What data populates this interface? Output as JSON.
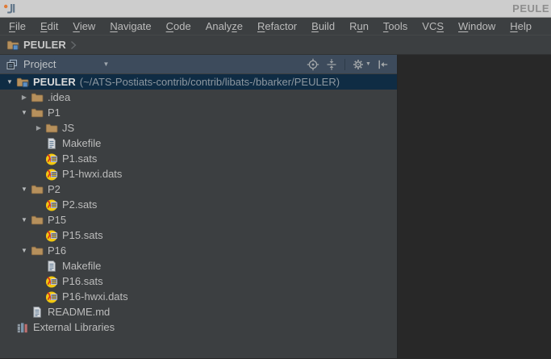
{
  "window": {
    "title": "PEULE"
  },
  "menu_bar": {
    "items": [
      {
        "label": "File",
        "mnemonic": 0
      },
      {
        "label": "Edit",
        "mnemonic": 0
      },
      {
        "label": "View",
        "mnemonic": 0
      },
      {
        "label": "Navigate",
        "mnemonic": 0
      },
      {
        "label": "Code",
        "mnemonic": 0
      },
      {
        "label": "Analyze",
        "mnemonic": 5
      },
      {
        "label": "Refactor",
        "mnemonic": 0
      },
      {
        "label": "Build",
        "mnemonic": 0
      },
      {
        "label": "Run",
        "mnemonic": 1
      },
      {
        "label": "Tools",
        "mnemonic": 0
      },
      {
        "label": "VCS",
        "mnemonic": 2
      },
      {
        "label": "Window",
        "mnemonic": 0
      },
      {
        "label": "Help",
        "mnemonic": 0
      }
    ]
  },
  "nav_bar": {
    "crumb": "PEULER"
  },
  "project_panel": {
    "header": {
      "title": "Project"
    },
    "tree": [
      {
        "label": "PEULER",
        "suffix": "(~/ATS-Postiats-contrib/contrib/libats-/bbarker/PEULER)",
        "level": 0,
        "arrow": "expanded",
        "icon": "project-folder",
        "selected": true,
        "bold": true
      },
      {
        "label": ".idea",
        "level": 1,
        "arrow": "collapsed",
        "icon": "folder"
      },
      {
        "label": "P1",
        "level": 1,
        "arrow": "expanded",
        "icon": "folder"
      },
      {
        "label": "JS",
        "level": 2,
        "arrow": "collapsed",
        "icon": "folder"
      },
      {
        "label": "Makefile",
        "level": 2,
        "icon": "text-file"
      },
      {
        "label": "P1.sats",
        "level": 2,
        "icon": "ats-file"
      },
      {
        "label": "P1-hwxi.dats",
        "level": 2,
        "icon": "ats-file"
      },
      {
        "label": "P2",
        "level": 1,
        "arrow": "expanded",
        "icon": "folder"
      },
      {
        "label": "P2.sats",
        "level": 2,
        "icon": "ats-file"
      },
      {
        "label": "P15",
        "level": 1,
        "arrow": "expanded",
        "icon": "folder"
      },
      {
        "label": "P15.sats",
        "level": 2,
        "icon": "ats-file"
      },
      {
        "label": "P16",
        "level": 1,
        "arrow": "expanded",
        "icon": "folder"
      },
      {
        "label": "Makefile",
        "level": 2,
        "icon": "text-file"
      },
      {
        "label": "P16.sats",
        "level": 2,
        "icon": "ats-file"
      },
      {
        "label": "P16-hwxi.dats",
        "level": 2,
        "icon": "ats-file"
      },
      {
        "label": "README.md",
        "level": 1,
        "icon": "text-file"
      },
      {
        "label": "External Libraries",
        "level": 0,
        "icon": "libraries"
      }
    ]
  },
  "colors": {
    "titlebar_bg": "#cdcdcd",
    "bar_bg": "#3c3f41",
    "tool_header_bg": "#3d4b5c",
    "selection_bg": "#0f2c44",
    "editor_bg": "#282828",
    "text": "#bbbbbb",
    "folder": "#b6905c",
    "project_square_blue": "#5c8fc4",
    "ats_yellow": "#f2c80f",
    "ats_red": "#d62f1f",
    "ats_blue": "#2746c4",
    "library_red": "#c07070",
    "library_blue": "#7d97ad"
  }
}
